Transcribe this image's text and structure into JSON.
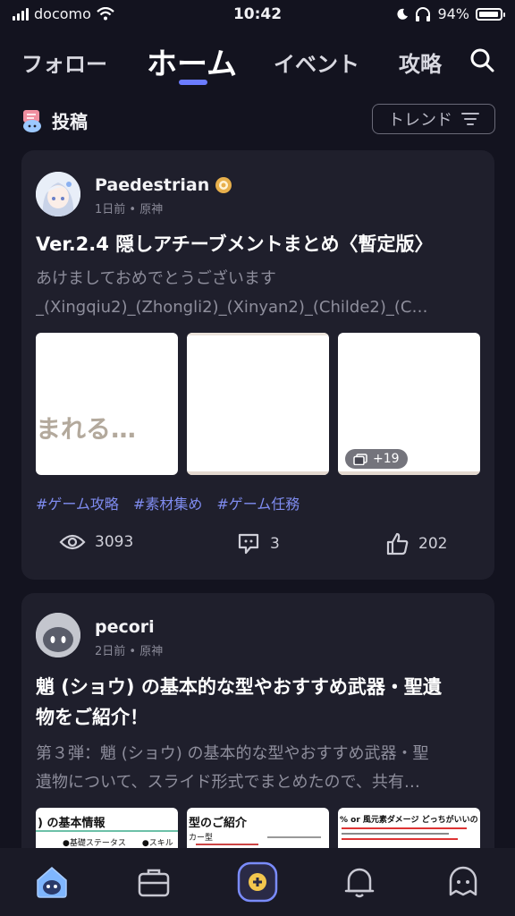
{
  "status": {
    "carrier": "docomo",
    "time": "10:42",
    "battery": "94%"
  },
  "nav": {
    "tabs": [
      "フォロー",
      "ホーム",
      "イベント",
      "攻略"
    ]
  },
  "section": {
    "title": "投稿",
    "trend_label": "トレンド"
  },
  "posts": [
    {
      "author": "Paedestrian",
      "meta": "1日前 • 原神",
      "title": "Ver.2.4 隠しアチーブメントまとめ〈暫定版〉",
      "excerpt": [
        "あけましておめでとうございます",
        "_(Xingqiu2)_(Zhongli2)_(Xinyan2)_(Childe2)_(C…"
      ],
      "thumb1_text": "まれる…",
      "more_badge": "+19",
      "tags": [
        "#ゲーム攻略",
        "#素材集め",
        "#ゲーム任務"
      ],
      "views": "3093",
      "comments": "3",
      "likes": "202"
    },
    {
      "author": "pecori",
      "meta": "2日前 • 原神",
      "title": [
        "魈 (ショウ) の基本的な型やおすすめ武器・聖遺",
        "物をご紹介！"
      ],
      "excerpt": [
        "第３弾：魈 (ショウ) の基本的な型やおすすめ武器・聖",
        "遺物について、スライド形式でまとめたので、共有…"
      ],
      "thumbs": [
        {
          "heading": ") の基本情報",
          "sub": "●基礎ステータス　　●スキル"
        },
        {
          "heading": "型のご紹介",
          "sub": "カー型"
        },
        {
          "heading": "% or 風元素ダメージ どっちがいいのか問題",
          "sub": ""
        }
      ]
    }
  ],
  "colors": {
    "accent": "#6b7cff",
    "tag": "#7f8cf0",
    "card": "#1f1f2c",
    "bg": "#13131f"
  }
}
